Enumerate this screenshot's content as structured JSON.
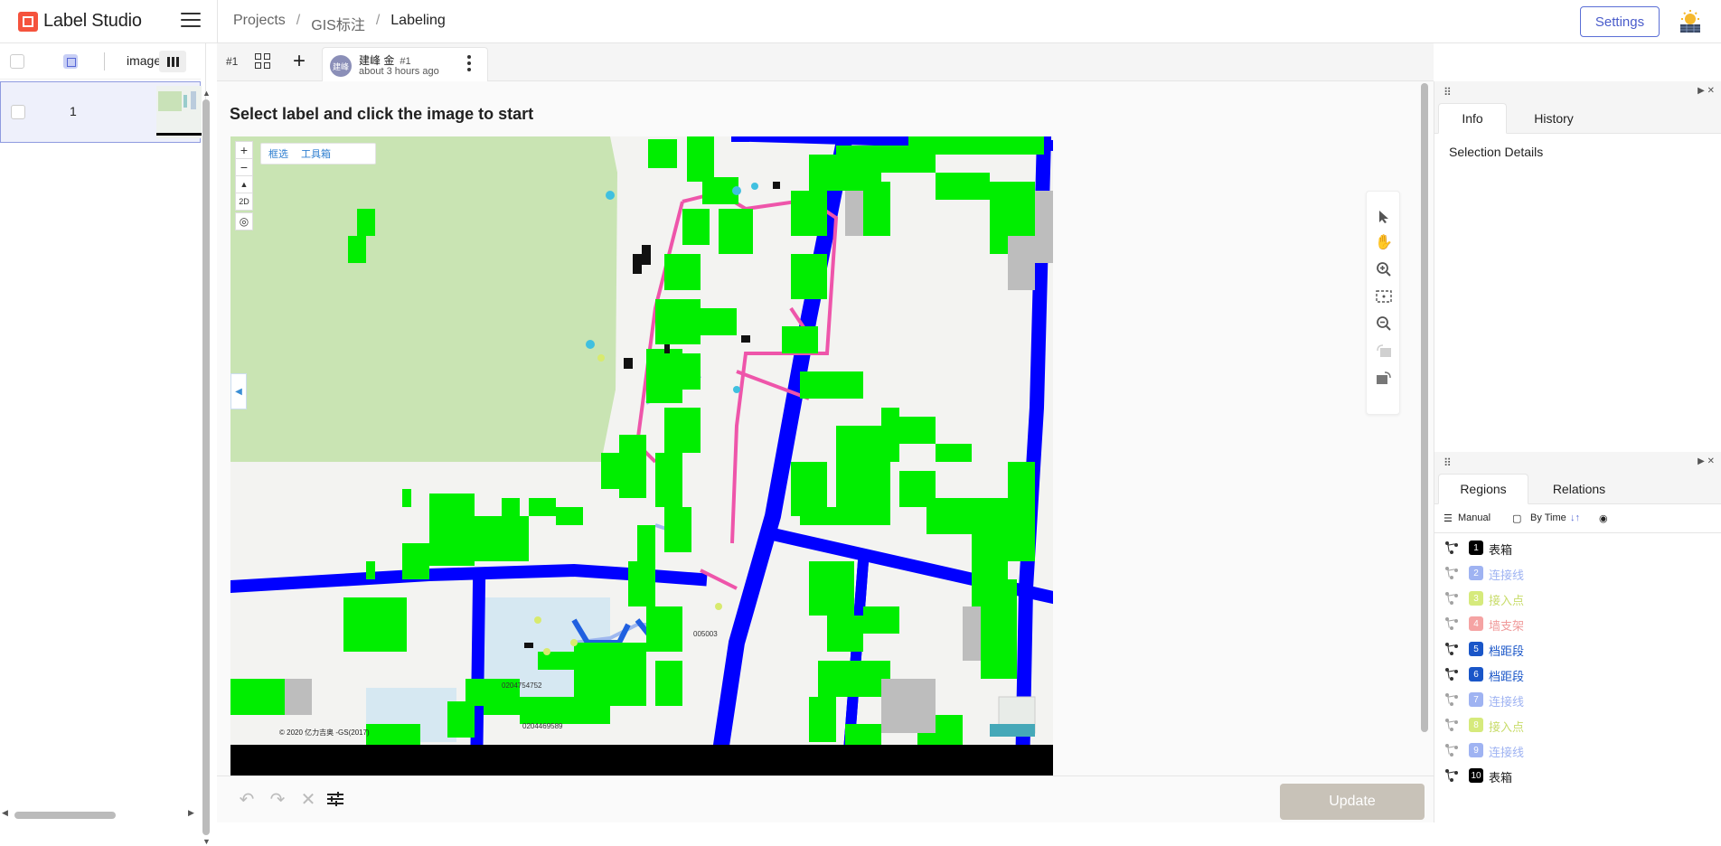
{
  "app": {
    "title": "Label Studio"
  },
  "breadcrumb": {
    "items": [
      "Projects",
      "GIS标注",
      "Labeling"
    ],
    "separator": "/"
  },
  "header": {
    "settings_label": "Settings"
  },
  "task_list": {
    "column_label": "image",
    "rows": [
      {
        "id": "1"
      }
    ]
  },
  "tabs": {
    "task_id": "#1",
    "annotation": {
      "avatar_text": "建峰",
      "user": "建峰 金",
      "number": "#1",
      "time": "about 3 hours ago"
    }
  },
  "editor": {
    "instruction": "Select label and click the image to start",
    "map": {
      "tool_select": "框选",
      "tool_box": "工具箱",
      "mode_2d": "2D",
      "copyright": "© 2020 亿力吉奥 -GS(2017)",
      "labels": [
        "0204754752",
        "0204469589",
        "005003"
      ]
    },
    "update_label": "Update"
  },
  "right_panel": {
    "tabs_top": [
      "Info",
      "History"
    ],
    "active_top": "Info",
    "selection_details": "Selection Details",
    "tabs_bottom": [
      "Regions",
      "Relations"
    ],
    "active_bottom": "Regions",
    "filters": {
      "manual": "Manual",
      "by_time": "By Time"
    },
    "regions": [
      {
        "num": "1",
        "label": "表箱",
        "color": "#000000",
        "text_color": "#222222",
        "faded": false
      },
      {
        "num": "2",
        "label": "连接线",
        "color": "#9fb3f2",
        "text_color": "#9fb3f2",
        "faded": true
      },
      {
        "num": "3",
        "label": "接入点",
        "color": "#d6ea7c",
        "text_color": "#c8dc6a",
        "faded": true
      },
      {
        "num": "4",
        "label": "墙支架",
        "color": "#f5a3a3",
        "text_color": "#f09a9a",
        "faded": true
      },
      {
        "num": "5",
        "label": "档距段",
        "color": "#1a56c8",
        "text_color": "#1a56c8",
        "faded": false
      },
      {
        "num": "6",
        "label": "档距段",
        "color": "#1a56c8",
        "text_color": "#1a56c8",
        "faded": false
      },
      {
        "num": "7",
        "label": "连接线",
        "color": "#9fb3f2",
        "text_color": "#9fb3f2",
        "faded": true
      },
      {
        "num": "8",
        "label": "接入点",
        "color": "#d6ea7c",
        "text_color": "#c8dc6a",
        "faded": true
      },
      {
        "num": "9",
        "label": "连接线",
        "color": "#9fb3f2",
        "text_color": "#9fb3f2",
        "faded": true
      },
      {
        "num": "10",
        "label": "表箱",
        "color": "#000000",
        "text_color": "#222222",
        "faded": false
      }
    ]
  },
  "colors": {
    "accent": "#5b6fd6",
    "brand": "#f5533d",
    "building": "#00ff00",
    "road": "#0000ff",
    "route": "#ee55aa"
  }
}
